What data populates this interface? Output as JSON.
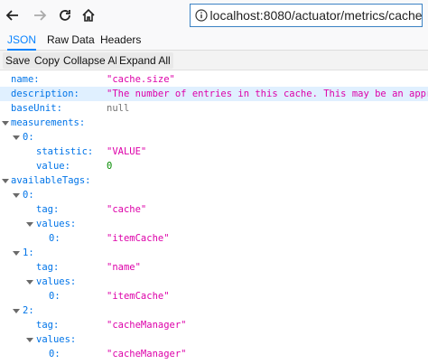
{
  "browser": {
    "url": "localhost:8080/actuator/metrics/cache.size"
  },
  "tabs": [
    "JSON",
    "Raw Data",
    "Headers"
  ],
  "toolbar": [
    "Save",
    "Copy",
    "Collapse All",
    "Expand All"
  ],
  "rows": [
    {
      "key": "name:",
      "value": "\"cache.size\"",
      "type": "str"
    },
    {
      "key": "description:",
      "value": "\"The number of entries in this cache. This may be an approx",
      "type": "str"
    },
    {
      "key": "baseUnit:",
      "value": "null",
      "type": "nul"
    },
    {
      "key": "measurements:",
      "value": "",
      "type": "obj"
    },
    {
      "key": "0:",
      "value": "",
      "type": "obj"
    },
    {
      "key": "statistic:",
      "value": "\"VALUE\"",
      "type": "str"
    },
    {
      "key": "value:",
      "value": "0",
      "type": "num"
    },
    {
      "key": "availableTags:",
      "value": "",
      "type": "obj"
    },
    {
      "key": "0:",
      "value": "",
      "type": "obj"
    },
    {
      "key": "tag:",
      "value": "\"cache\"",
      "type": "str"
    },
    {
      "key": "values:",
      "value": "",
      "type": "obj"
    },
    {
      "key": "0:",
      "value": "\"itemCache\"",
      "type": "str"
    },
    {
      "key": "1:",
      "value": "",
      "type": "obj"
    },
    {
      "key": "tag:",
      "value": "\"name\"",
      "type": "str"
    },
    {
      "key": "values:",
      "value": "",
      "type": "obj"
    },
    {
      "key": "0:",
      "value": "\"itemCache\"",
      "type": "str"
    },
    {
      "key": "2:",
      "value": "",
      "type": "obj"
    },
    {
      "key": "tag:",
      "value": "\"cacheManager\"",
      "type": "str"
    },
    {
      "key": "values:",
      "value": "",
      "type": "obj"
    },
    {
      "key": "0:",
      "value": "\"cacheManager\"",
      "type": "str"
    }
  ]
}
